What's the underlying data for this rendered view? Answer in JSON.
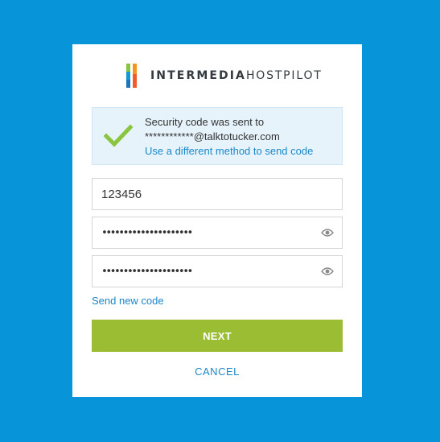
{
  "logo": {
    "brand_bold": "INTERMEDIA",
    "brand_light": "HOSTPILOT"
  },
  "alert": {
    "line1": "Security code was sent to",
    "line2": "************@talktotucker.com",
    "link": "Use a different method to send code",
    "icon": "check-icon",
    "icon_color": "#8bc53f"
  },
  "form": {
    "code_value": "123456",
    "new_password_value": "*********************",
    "confirm_password_value": "*********************",
    "eye_icon": "eye-icon",
    "send_new_code": "Send new code",
    "next_label": "NEXT",
    "cancel_label": "CANCEL"
  },
  "colors": {
    "background": "#0894d8",
    "accent_button": "#9abd33",
    "link": "#1a88c9"
  }
}
